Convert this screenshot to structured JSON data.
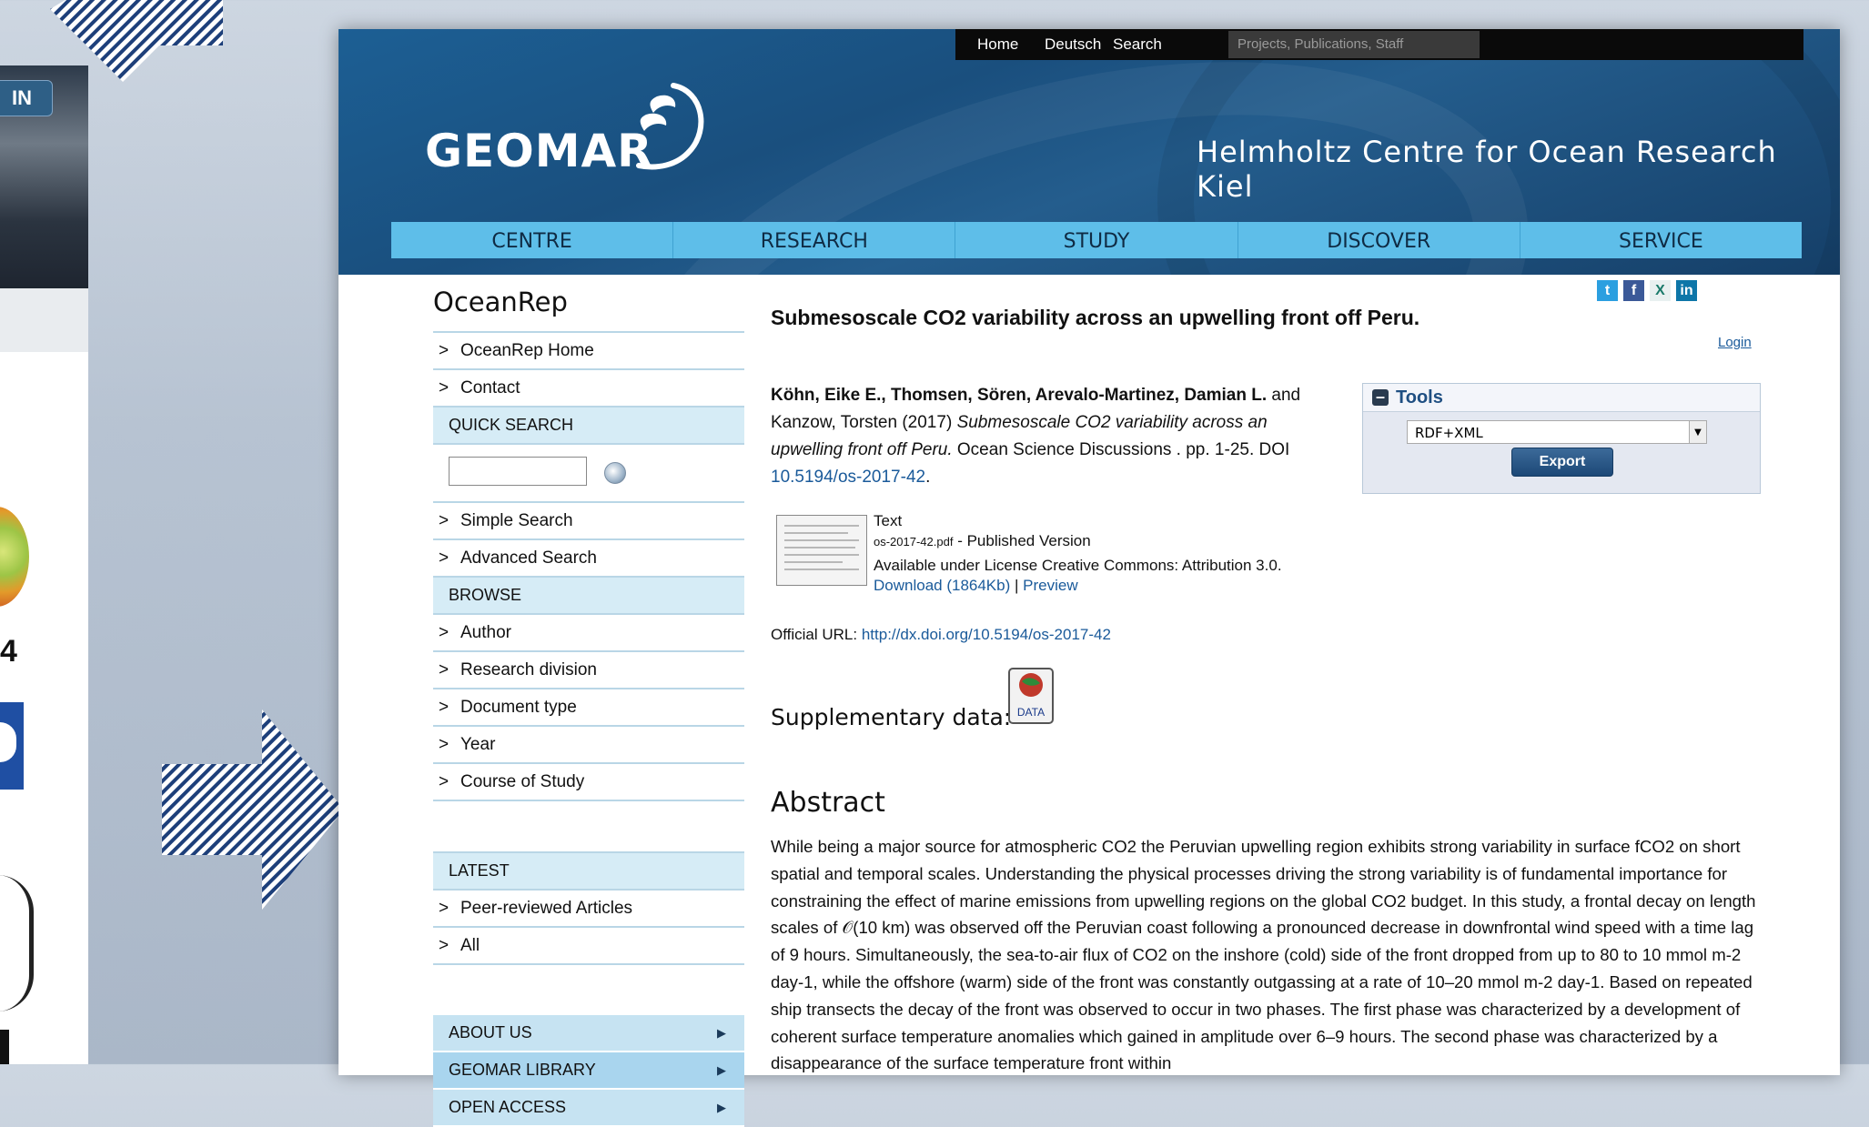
{
  "backdrop": {
    "signin_label": "IN",
    "logo_number": "4"
  },
  "topbar": {
    "links": [
      "Home",
      "Deutsch",
      "Search"
    ],
    "search_placeholder": "Projects, Publications, Staff"
  },
  "header": {
    "brand": "GEOMAR",
    "tagline": "Helmholtz Centre for Ocean Research Kiel"
  },
  "nav": [
    "CENTRE",
    "RESEARCH",
    "STUDY",
    "DISCOVER",
    "SERVICE"
  ],
  "sidebar": {
    "title": "OceanRep",
    "links_top": [
      "OceanRep Home",
      "Contact"
    ],
    "quick_search": "QUICK SEARCH",
    "search_links": [
      "Simple Search",
      "Advanced Search"
    ],
    "browse": "BROWSE",
    "browse_links": [
      "Author",
      "Research division",
      "Document type",
      "Year",
      "Course of Study"
    ],
    "latest": "LATEST",
    "latest_links": [
      "Peer-reviewed Articles",
      "All"
    ],
    "blocks": [
      "ABOUT US",
      "GEOMAR LIBRARY",
      "OPEN ACCESS"
    ]
  },
  "article": {
    "title": "Submesoscale CO2 variability across an upwelling front off Peru.",
    "login": "Login",
    "authors_bold": "Köhn, Eike E., Thomsen, Sören, Arevalo-Martinez, Damian L.",
    "authors_and": "and",
    "authors_rest": "Kanzow, Torsten (2017)",
    "title_italic": "Submesoscale CO2 variability across an upwelling front off Peru.",
    "journal": "Ocean Science Discussions . pp. 1-25. DOI",
    "doi": "10.5194/os-2017-42",
    "doi_end": ".",
    "file_type": "Text",
    "file_name": "os-2017-42.pdf",
    "file_version": "- Published Version",
    "license": "Available under License Creative Commons: Attribution 3.0.",
    "download": "Download (1864Kb)",
    "sep": "|",
    "preview": "Preview",
    "official_label": "Official URL:",
    "official_url": "http://dx.doi.org/10.5194/os-2017-42",
    "supplementary": "Supplementary data:",
    "data_icon_label": "DATA",
    "abstract_heading": "Abstract",
    "abstract": "While being a major source for atmospheric CO2 the Peruvian upwelling region exhibits strong variability in surface fCO2 on short spatial and temporal scales. Understanding the physical processes driving the strong variability is of fundamental importance for constraining the effect of marine emissions from upwelling regions on the global CO2 budget. In this study, a frontal decay on length scales of 𝒪(10 km) was observed off the Peruvian coast following a pronounced decrease in downfrontal wind speed with a time lag of 9 hours. Simultaneously, the sea-to-air flux of CO2 on the inshore (cold) side of the front dropped from up to 80 to 10 mmol m-2 day-1, while the offshore (warm) side of the front was constantly outgassing at a rate of 10–20 mmol m-2 day-1. Based on repeated ship transects the decay of the front was observed to occur in two phases. The first phase was characterized by a development of coherent surface temperature anomalies which gained in amplitude over 6–9 hours. The second phase was characterized by a disappearance of the surface temperature front within"
  },
  "tools": {
    "title": "Tools",
    "select_value": "RDF+XML",
    "export": "Export"
  },
  "colors": {
    "nav_bg": "#5ebee9",
    "header_bg": "#1a4f7e",
    "sidebar_heading_bg": "#d6ecf6",
    "link": "#1a5a9a"
  }
}
